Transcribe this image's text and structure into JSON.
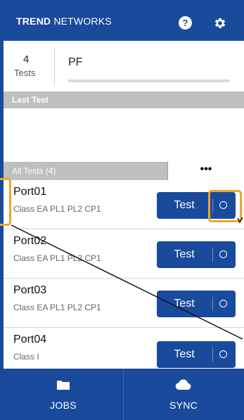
{
  "appbar": {
    "brand_bold": "TREND",
    "brand_rest": " NETWORKS",
    "help_icon": "help-icon",
    "settings_icon": "gear-icon"
  },
  "summary": {
    "tests_count": "4",
    "tests_label": "Tests",
    "project_name": "PF"
  },
  "last_test": {
    "header": "Last Test"
  },
  "all_tests": {
    "label": "All Tests (4)",
    "more_label": "•••"
  },
  "tests": [
    {
      "name": "Port01",
      "detail": "Class EA PL1 PL2 CP1",
      "button": "Test",
      "option_icon": "circle-icon"
    },
    {
      "name": "Port02",
      "detail": "Class EA PL1 PL2 CP1",
      "button": "Test",
      "option_icon": "circle-icon"
    },
    {
      "name": "Port03",
      "detail": "Class EA PL1 PL2 CP1",
      "button": "Test",
      "option_icon": "circle-icon"
    },
    {
      "name": "Port04",
      "detail": "Class I",
      "button": "Test",
      "option_icon": "circle-icon"
    }
  ],
  "bottom_nav": {
    "jobs_label": "JOBS",
    "jobs_icon": "folder-icon",
    "sync_label": "SYNC",
    "sync_icon": "cloud-icon"
  },
  "colors": {
    "primary": "#1a4a9c",
    "highlight": "#f1a42a",
    "section_header": "#bfbfbf"
  }
}
